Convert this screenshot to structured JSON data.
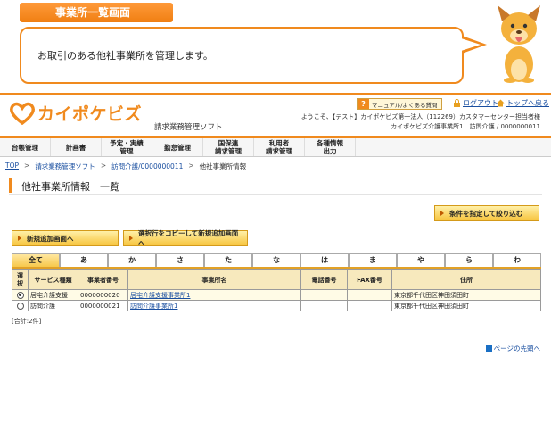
{
  "banner": {
    "title": "事業所一覧画面",
    "description": "お取引のある他社事業所を管理します。"
  },
  "header": {
    "logo_text": "カイポケビズ",
    "logo_sub": "請求業務管理ソフト",
    "help_label": "マニュアル/よくある質問",
    "logout_label": "ログアウト",
    "top_link_label": "トップへ戻る",
    "welcome_line1": "ようこそ、【テスト】カイポケビズ第一法人（112269）カスタマーセンター担当者様",
    "welcome_line2": "カイポケビズ介護事業所1　訪問介護 / 0000000011"
  },
  "nav": {
    "items": [
      {
        "label": "台帳管理"
      },
      {
        "label": "計画書"
      },
      {
        "label": "予定・実績\n管理"
      },
      {
        "label": "勤怠管理"
      },
      {
        "label": "国保連\n請求管理"
      },
      {
        "label": "利用者\n請求管理"
      },
      {
        "label": "各種情報\n出力"
      }
    ]
  },
  "breadcrumb": {
    "top": "TOP",
    "item1": "請求業務管理ソフト",
    "item2": "訪問介護/0000000011",
    "current": "他社事業所情報"
  },
  "page": {
    "title": "他社事業所情報　一覧",
    "filter_button": "条件を指定して絞り込む",
    "new_button": "新規追加画面へ",
    "copy_button": "選択行をコピーして新規追加画面へ"
  },
  "tabs": [
    "全て",
    "あ",
    "か",
    "さ",
    "た",
    "な",
    "は",
    "ま",
    "や",
    "ら",
    "わ"
  ],
  "table": {
    "headers": {
      "select": "選\n択",
      "service": "サービス種類",
      "number": "事業者番号",
      "name": "事業所名",
      "phone": "電話番号",
      "fax": "FAX番号",
      "address": "住所"
    },
    "rows": [
      {
        "selected": true,
        "service": "居宅介護支援",
        "number": "0000000020",
        "name": "居宅介護支援事業所1",
        "phone": "",
        "fax": "",
        "address": "東京都千代田区神田須田町"
      },
      {
        "selected": false,
        "service": "訪問介護",
        "number": "0000000021",
        "name": "訪問介護事業所1",
        "phone": "",
        "fax": "",
        "address": "東京都千代田区神田須田町"
      }
    ],
    "total": "[合計:2件]"
  },
  "footer": {
    "page_top": "ページの先頭へ"
  },
  "colors": {
    "accent": "#f08a1e",
    "button": "#f7c43d",
    "header_cell": "#f7e9bd",
    "link": "#1a4fa0"
  }
}
